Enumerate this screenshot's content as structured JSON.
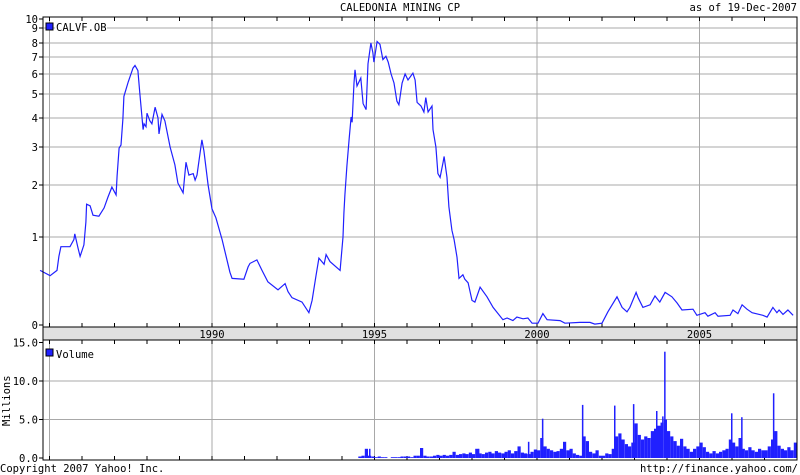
{
  "header": {
    "title": "CALEDONIA MINING CP",
    "as_of": "as of 19-Dec-2007"
  },
  "footer": {
    "copyright": "Copyright 2007 Yahoo! Inc.",
    "url": "http://finance.yahoo.com/"
  },
  "colors": {
    "series": "#2020ff",
    "grid": "#a8a8a8",
    "band": "#e0e0e0"
  },
  "chart_data": [
    {
      "type": "line",
      "title": "CALEDONIA MINING CP",
      "legend": "CALVF.OB",
      "legend_position": "top-left",
      "xlabel": "",
      "ylabel": "",
      "x_ticks": [
        "1990",
        "1995",
        "2000",
        "2005"
      ],
      "x_tick_values": [
        1990,
        1995,
        2000,
        2005
      ],
      "xlim": [
        1984.7,
        2007.97
      ],
      "y_ticks": [
        "10",
        "9",
        "8",
        "7",
        "6",
        "5",
        "4",
        "3",
        "2",
        "1",
        "0"
      ],
      "y_tick_values": [
        10,
        9,
        8,
        7,
        6,
        5,
        4,
        3,
        2,
        1,
        0
      ],
      "ylim": [
        0,
        10
      ],
      "grid": true,
      "points": [
        [
          1984.71,
          0.62
        ],
        [
          1985.02,
          0.56
        ],
        [
          1985.23,
          0.62
        ],
        [
          1985.29,
          0.78
        ],
        [
          1985.35,
          0.89
        ],
        [
          1985.63,
          0.89
        ],
        [
          1985.75,
          0.97
        ],
        [
          1985.78,
          1.06
        ],
        [
          1985.88,
          0.87
        ],
        [
          1985.94,
          0.78
        ],
        [
          1986.06,
          0.91
        ],
        [
          1986.12,
          1.29
        ],
        [
          1986.14,
          1.63
        ],
        [
          1986.25,
          1.6
        ],
        [
          1986.34,
          1.42
        ],
        [
          1986.52,
          1.4
        ],
        [
          1986.68,
          1.56
        ],
        [
          1986.8,
          1.77
        ],
        [
          1986.92,
          1.96
        ],
        [
          1987.05,
          1.81
        ],
        [
          1987.08,
          2.24
        ],
        [
          1987.14,
          2.97
        ],
        [
          1987.2,
          3.07
        ],
        [
          1987.26,
          3.97
        ],
        [
          1987.29,
          4.9
        ],
        [
          1987.42,
          5.6
        ],
        [
          1987.57,
          6.35
        ],
        [
          1987.63,
          6.5
        ],
        [
          1987.72,
          6.2
        ],
        [
          1987.78,
          5.05
        ],
        [
          1987.88,
          3.6
        ],
        [
          1987.91,
          3.8
        ],
        [
          1987.97,
          3.7
        ],
        [
          1988.0,
          4.2
        ],
        [
          1988.09,
          3.9
        ],
        [
          1988.15,
          3.8
        ],
        [
          1988.25,
          4.45
        ],
        [
          1988.34,
          4.0
        ],
        [
          1988.37,
          3.45
        ],
        [
          1988.46,
          4.15
        ],
        [
          1988.55,
          3.9
        ],
        [
          1988.71,
          3.0
        ],
        [
          1988.86,
          2.53
        ],
        [
          1988.95,
          2.05
        ],
        [
          1989.11,
          1.85
        ],
        [
          1989.2,
          2.6
        ],
        [
          1989.29,
          2.26
        ],
        [
          1989.42,
          2.3
        ],
        [
          1989.48,
          2.13
        ],
        [
          1989.54,
          2.26
        ],
        [
          1989.69,
          3.25
        ],
        [
          1989.75,
          2.9
        ],
        [
          1989.88,
          2.0
        ],
        [
          1990.0,
          1.54
        ],
        [
          1990.12,
          1.37
        ],
        [
          1990.31,
          0.97
        ],
        [
          1990.55,
          0.6
        ],
        [
          1990.62,
          0.53
        ],
        [
          1990.98,
          0.52
        ],
        [
          1991.11,
          0.66
        ],
        [
          1991.17,
          0.7
        ],
        [
          1991.38,
          0.74
        ],
        [
          1991.54,
          0.62
        ],
        [
          1991.72,
          0.49
        ],
        [
          1992.03,
          0.4
        ],
        [
          1992.25,
          0.47
        ],
        [
          1992.34,
          0.38
        ],
        [
          1992.46,
          0.31
        ],
        [
          1992.77,
          0.26
        ],
        [
          1992.98,
          0.14
        ],
        [
          1993.08,
          0.28
        ],
        [
          1993.2,
          0.56
        ],
        [
          1993.29,
          0.76
        ],
        [
          1993.45,
          0.69
        ],
        [
          1993.51,
          0.8
        ],
        [
          1993.63,
          0.72
        ],
        [
          1993.94,
          0.62
        ],
        [
          1994.03,
          1.0
        ],
        [
          1994.06,
          1.46
        ],
        [
          1994.09,
          1.81
        ],
        [
          1994.15,
          2.5
        ],
        [
          1994.22,
          3.3
        ],
        [
          1994.28,
          4.04
        ],
        [
          1994.31,
          3.85
        ],
        [
          1994.37,
          5.55
        ],
        [
          1994.4,
          6.25
        ],
        [
          1994.46,
          5.4
        ],
        [
          1994.58,
          5.8
        ],
        [
          1994.65,
          4.6
        ],
        [
          1994.74,
          4.35
        ],
        [
          1994.8,
          6.6
        ],
        [
          1994.89,
          8.0
        ],
        [
          1994.95,
          7.3
        ],
        [
          1994.98,
          6.7
        ],
        [
          1995.08,
          8.1
        ],
        [
          1995.17,
          7.9
        ],
        [
          1995.26,
          6.85
        ],
        [
          1995.35,
          7.05
        ],
        [
          1995.42,
          6.7
        ],
        [
          1995.51,
          6.0
        ],
        [
          1995.6,
          5.55
        ],
        [
          1995.69,
          4.7
        ],
        [
          1995.75,
          4.55
        ],
        [
          1995.85,
          5.55
        ],
        [
          1995.94,
          6.0
        ],
        [
          1996.03,
          5.7
        ],
        [
          1996.18,
          6.05
        ],
        [
          1996.25,
          5.7
        ],
        [
          1996.31,
          4.65
        ],
        [
          1996.43,
          4.5
        ],
        [
          1996.52,
          4.25
        ],
        [
          1996.58,
          4.85
        ],
        [
          1996.65,
          4.25
        ],
        [
          1996.77,
          4.5
        ],
        [
          1996.8,
          3.6
        ],
        [
          1996.89,
          3.0
        ],
        [
          1996.95,
          2.3
        ],
        [
          1997.02,
          2.2
        ],
        [
          1997.11,
          2.6
        ],
        [
          1997.14,
          2.75
        ],
        [
          1997.23,
          2.2
        ],
        [
          1997.29,
          1.58
        ],
        [
          1997.38,
          1.13
        ],
        [
          1997.45,
          0.97
        ],
        [
          1997.54,
          0.77
        ],
        [
          1997.6,
          0.53
        ],
        [
          1997.72,
          0.57
        ],
        [
          1997.78,
          0.52
        ],
        [
          1997.88,
          0.48
        ],
        [
          1998.0,
          0.28
        ],
        [
          1998.09,
          0.26
        ],
        [
          1998.25,
          0.43
        ],
        [
          1998.46,
          0.32
        ],
        [
          1998.65,
          0.2
        ],
        [
          1998.95,
          0.06
        ],
        [
          1999.08,
          0.08
        ],
        [
          1999.26,
          0.05
        ],
        [
          1999.38,
          0.09
        ],
        [
          1999.57,
          0.07
        ],
        [
          1999.72,
          0.08
        ],
        [
          1999.85,
          0.02
        ],
        [
          2000.03,
          0.02
        ],
        [
          2000.18,
          0.13
        ],
        [
          2000.31,
          0.06
        ],
        [
          2000.71,
          0.05
        ],
        [
          2000.86,
          0.02
        ],
        [
          2001.32,
          0.03
        ],
        [
          2001.63,
          0.03
        ],
        [
          2001.78,
          0.01
        ],
        [
          2002.0,
          0.02
        ],
        [
          2002.18,
          0.15
        ],
        [
          2002.46,
          0.32
        ],
        [
          2002.62,
          0.2
        ],
        [
          2002.77,
          0.15
        ],
        [
          2002.86,
          0.2
        ],
        [
          2003.05,
          0.37
        ],
        [
          2003.11,
          0.31
        ],
        [
          2003.26,
          0.2
        ],
        [
          2003.48,
          0.23
        ],
        [
          2003.63,
          0.33
        ],
        [
          2003.78,
          0.26
        ],
        [
          2003.94,
          0.37
        ],
        [
          2004.15,
          0.32
        ],
        [
          2004.31,
          0.25
        ],
        [
          2004.46,
          0.17
        ],
        [
          2004.8,
          0.18
        ],
        [
          2004.92,
          0.11
        ],
        [
          2005.17,
          0.14
        ],
        [
          2005.26,
          0.1
        ],
        [
          2005.48,
          0.14
        ],
        [
          2005.57,
          0.1
        ],
        [
          2005.94,
          0.11
        ],
        [
          2006.03,
          0.17
        ],
        [
          2006.18,
          0.13
        ],
        [
          2006.31,
          0.23
        ],
        [
          2006.46,
          0.18
        ],
        [
          2006.62,
          0.14
        ],
        [
          2006.95,
          0.11
        ],
        [
          2007.08,
          0.09
        ],
        [
          2007.26,
          0.2
        ],
        [
          2007.38,
          0.14
        ],
        [
          2007.45,
          0.17
        ],
        [
          2007.57,
          0.12
        ],
        [
          2007.72,
          0.17
        ],
        [
          2007.88,
          0.11
        ]
      ]
    },
    {
      "type": "bar",
      "legend": "Volume",
      "legend_position": "top-left",
      "ylabel": "Millions",
      "y_ticks": [
        "15.0",
        "10.0",
        "5.0",
        "0.0"
      ],
      "y_tick_values": [
        15,
        10,
        5,
        0
      ],
      "ylim": [
        0,
        15
      ],
      "grid": true,
      "start": 1994.5,
      "step": 0.1,
      "values": [
        0.2,
        0.3,
        1.2,
        0.3,
        0.2,
        0.1,
        0.2,
        0.1,
        0.1,
        0,
        0.1,
        0.1,
        0.1,
        0.2,
        0.2,
        0.2,
        0.1,
        0.3,
        0.3,
        1.3,
        0.3,
        0.2,
        0.2,
        0.3,
        0.4,
        0.3,
        0.4,
        0.3,
        0.4,
        0.8,
        0.4,
        0.5,
        0.6,
        0.5,
        0.7,
        0.5,
        1.2,
        0.6,
        0.5,
        0.7,
        0.8,
        0.6,
        0.9,
        0.7,
        0.6,
        0.8,
        1.0,
        0.6,
        0.9,
        1.5,
        0.7,
        0.6,
        0.5,
        0.8,
        1.1,
        1.0,
        2.6,
        1.5,
        1.2,
        1.0,
        0.8,
        0.9,
        1.2,
        2.1,
        1.0,
        1.2,
        0.6,
        0.4,
        0.3,
        2.8,
        2.2,
        0.8,
        0.6,
        1.0,
        0.3,
        0.3,
        0.6,
        0.5,
        1.2,
        2.8,
        3.2,
        2.4,
        1.8,
        1.5,
        2.0,
        4.5,
        3.0,
        2.4,
        2.8,
        2.6,
        3.5,
        3.8,
        4.2,
        4.6,
        5.0,
        3.5,
        2.8,
        2.2,
        1.6,
        2.5,
        1.5,
        1.2,
        0.8,
        1.2,
        1.5,
        2.0,
        1.4,
        0.8,
        0.6,
        0.9,
        0.6,
        0.8,
        1.0,
        1.2,
        2.4,
        2.0,
        1.5,
        2.6,
        1.2,
        1.0,
        1.4,
        1.0,
        0.8,
        1.2,
        1.0,
        1.0,
        1.5,
        2.4,
        3.5,
        1.6,
        1.2,
        1.0,
        1.4,
        1.0,
        2.0
      ],
      "spikes": [
        [
          1994.83,
          1.2
        ],
        [
          1996.43,
          1.3
        ],
        [
          1998.18,
          1.2
        ],
        [
          1999.72,
          2.1
        ],
        [
          2000.15,
          5.1
        ],
        [
          2001.38,
          6.9
        ],
        [
          2002.37,
          6.8
        ],
        [
          2002.95,
          7.0
        ],
        [
          2003.66,
          6.1
        ],
        [
          2003.85,
          5.4
        ],
        [
          2003.91,
          13.8
        ],
        [
          2005.97,
          5.8
        ],
        [
          2006.28,
          5.3
        ],
        [
          2007.26,
          8.4
        ]
      ]
    }
  ]
}
